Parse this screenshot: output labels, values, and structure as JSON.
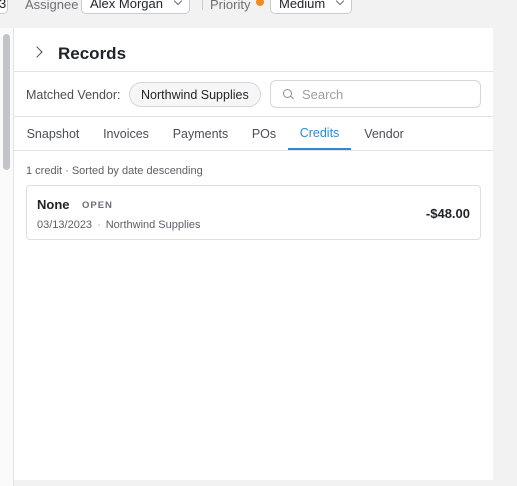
{
  "topbar": {
    "left_chip_fragment": "3",
    "assignee_label": "Assignee",
    "assignee_value": "Alex Morgan",
    "priority_label": "Priority",
    "priority_value": "Medium",
    "priority_color": "#f08c1a"
  },
  "records": {
    "title": "Records",
    "matched_vendor_label": "Matched Vendor:",
    "matched_vendor_value": "Northwind Supplies",
    "search_placeholder": "Search",
    "tabs": [
      {
        "label": "Snapshot",
        "active": false
      },
      {
        "label": "Invoices",
        "active": false
      },
      {
        "label": "Payments",
        "active": false
      },
      {
        "label": "POs",
        "active": false
      },
      {
        "label": "Credits",
        "active": true
      },
      {
        "label": "Vendor",
        "active": false
      }
    ],
    "summary": "1 credit · Sorted by date descending",
    "credits": [
      {
        "name": "None",
        "status": "OPEN",
        "date": "03/13/2023",
        "vendor": "Northwind Supplies",
        "amount": "-$48.00"
      }
    ]
  },
  "accent_color": "#2b8bd6"
}
